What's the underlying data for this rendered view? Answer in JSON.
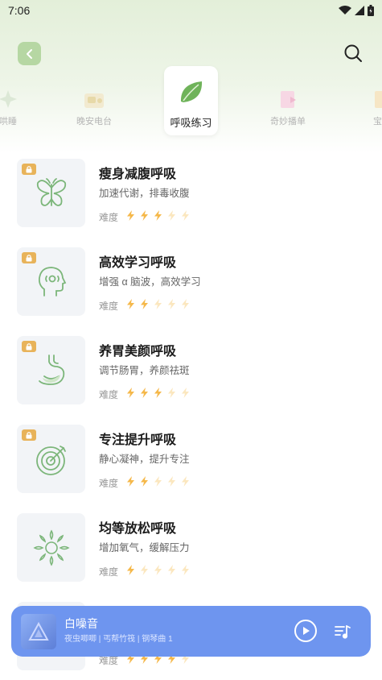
{
  "status": {
    "time": "7:06"
  },
  "header": {
    "back": "back",
    "search": "search"
  },
  "categories": [
    {
      "label": "哄睡",
      "icon": "sleep-icon"
    },
    {
      "label": "晚安电台",
      "icon": "radio-icon"
    },
    {
      "label": "呼吸练习",
      "icon": "leaf-icon",
      "active": true
    },
    {
      "label": "奇妙播单",
      "icon": "playlist-icon"
    },
    {
      "label": "宝藏",
      "icon": "treasure-icon"
    }
  ],
  "items": [
    {
      "title": "瘦身减腹呼吸",
      "subtitle": "加速代谢，排毒收腹",
      "difficulty_label": "难度",
      "difficulty": 3,
      "max": 5,
      "icon": "butterfly-icon",
      "locked": true
    },
    {
      "title": "高效学习呼吸",
      "subtitle": "增强 α 脑波，高效学习",
      "difficulty_label": "难度",
      "difficulty": 2,
      "max": 5,
      "icon": "brain-head-icon",
      "locked": true
    },
    {
      "title": "养胃美颜呼吸",
      "subtitle": "调节肠胃，养颜祛斑",
      "difficulty_label": "难度",
      "difficulty": 3,
      "max": 5,
      "icon": "stomach-icon",
      "locked": true
    },
    {
      "title": "专注提升呼吸",
      "subtitle": "静心凝神，提升专注",
      "difficulty_label": "难度",
      "difficulty": 2,
      "max": 5,
      "icon": "target-icon",
      "locked": true
    },
    {
      "title": "均等放松呼吸",
      "subtitle": "增加氧气，缓解压力",
      "difficulty_label": "难度",
      "difficulty": 1,
      "max": 5,
      "icon": "sun-leaf-icon",
      "locked": false
    },
    {
      "title": "",
      "subtitle": "",
      "difficulty_label": "难度",
      "difficulty": 4,
      "max": 5,
      "icon": "partial-icon",
      "locked": false
    }
  ],
  "player": {
    "title": "白噪音",
    "subtitle": "夜虫唧唧 | 丐帮竹筏 | 钢琴曲 1",
    "accent": "#6e95ef"
  },
  "colors": {
    "green": "#7cb67a",
    "bolt_on": "#f5b84a",
    "bolt_off": "#fbe7bf",
    "lock": "#e8b35a"
  }
}
